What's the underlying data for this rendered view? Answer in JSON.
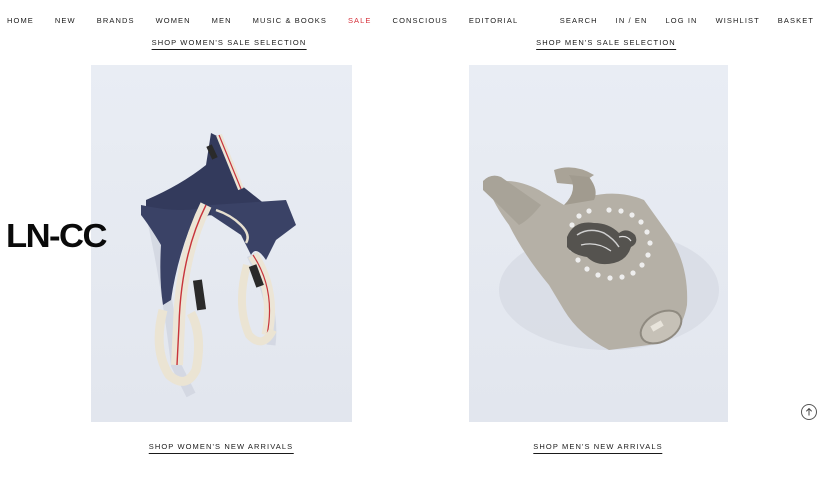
{
  "nav": {
    "left": [
      {
        "label": "HOME"
      },
      {
        "label": "NEW"
      },
      {
        "label": "BRANDS"
      },
      {
        "label": "WOMEN"
      },
      {
        "label": "MEN"
      },
      {
        "label": "MUSIC & BOOKS"
      },
      {
        "label": "SALE"
      },
      {
        "label": "CONSCIOUS"
      },
      {
        "label": "EDITORIAL"
      }
    ],
    "right": [
      {
        "label": "SEARCH"
      },
      {
        "label": "IN / EN"
      },
      {
        "label": "LOG IN"
      },
      {
        "label": "WISHLIST"
      },
      {
        "label": "BASKET"
      }
    ]
  },
  "colors": {
    "sale": "#d6303a",
    "photo_bg": "#e7ebf2"
  },
  "sale_links": {
    "women": "SHOP WOMEN'S SALE SELECTION",
    "men": "SHOP MEN'S SALE SELECTION"
  },
  "arrival_links": {
    "women": "SHOP WOMEN'S NEW ARRIVALS",
    "men": "SHOP MEN'S NEW ARRIVALS"
  },
  "logo": "LN-CC",
  "icons": {
    "scroll": "arrow-up-circle-icon"
  }
}
